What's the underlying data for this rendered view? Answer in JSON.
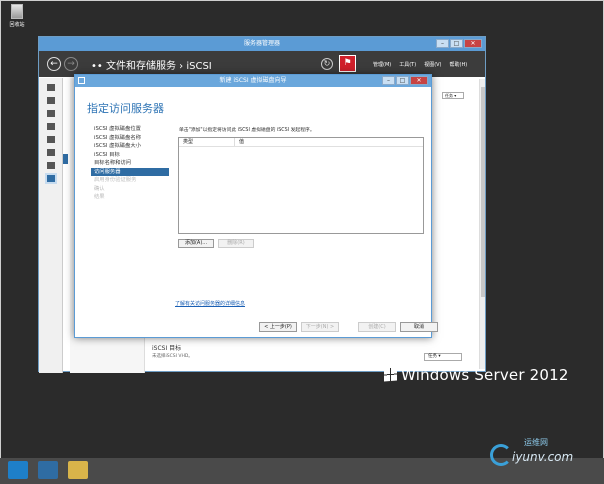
{
  "desktop": {
    "recycle_bin_label": "回收站"
  },
  "server_manager": {
    "title": "服务器管理器",
    "breadcrumb": "•• 文件和存储服务 › iSCSI",
    "menus": [
      "管理(M)",
      "工具(T)",
      "视图(V)",
      "帮助(H)"
    ],
    "tasks_top": "任务 ▾",
    "iscsi_section_title": "iSCSI 目标",
    "iscsi_section_sub": "未选择iSCSI VHD。",
    "tasks_bottom": "任务 ▾"
  },
  "wizard": {
    "title": "新建 iSCSI 虚拟磁盘向导",
    "heading": "指定访问服务器",
    "steps": [
      {
        "label": "iSCSI 虚拟磁盘位置",
        "state": "done"
      },
      {
        "label": "iSCSI 虚拟磁盘名称",
        "state": "done"
      },
      {
        "label": "iSCSI 虚拟磁盘大小",
        "state": "done"
      },
      {
        "label": "iSCSI 目标",
        "state": "done"
      },
      {
        "label": "目标名称和访问",
        "state": "done"
      },
      {
        "label": "访问服务器",
        "state": "active"
      },
      {
        "label": "启用身份验证服务",
        "state": "off"
      },
      {
        "label": "确认",
        "state": "off"
      },
      {
        "label": "结果",
        "state": "off"
      }
    ],
    "instruction": "单击\"添加\"以指定将访问此 iSCSI 虚拟磁盘的 iSCSI 发起程序。",
    "columns": [
      "类型",
      "值"
    ],
    "add_button": "添加(A)...",
    "remove_button": "删除(R)",
    "more_link": "了解有关访问服务器的详细信息",
    "prev_button": "< 上一步(P)",
    "next_button": "下一步(N) >",
    "create_button": "创建(C)",
    "cancel_button": "取消"
  },
  "branding": {
    "windows_server": "Windows Server 2012"
  },
  "watermark": {
    "cn": "运维网",
    "site": "iyunv.com"
  }
}
